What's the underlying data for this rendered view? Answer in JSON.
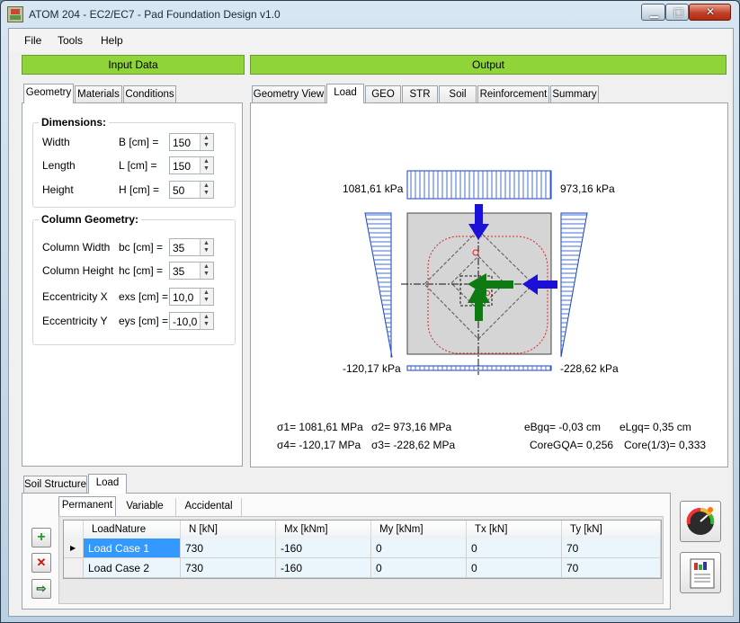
{
  "window": {
    "title": "ATOM 204 - EC2/EC7 - Pad Foundation Design v1.0"
  },
  "controls": {
    "min": "▁",
    "max": "□",
    "close": "✕"
  },
  "menu": [
    "File",
    "Tools",
    "Help"
  ],
  "header": {
    "input": "Input Data",
    "output": "Output"
  },
  "input_tabs": [
    "Geometry",
    "Materials",
    "Conditions"
  ],
  "dimensions": {
    "title": "Dimensions:",
    "rows": [
      {
        "label": "Width",
        "symbol": "B [cm] =",
        "value": "150"
      },
      {
        "label": "Length",
        "symbol": "L [cm] =",
        "value": "150"
      },
      {
        "label": "Height",
        "symbol": "H [cm] =",
        "value": "50"
      }
    ]
  },
  "column": {
    "title": "Column Geometry:",
    "rows": [
      {
        "label": "Column Width",
        "symbol": "bc [cm] =",
        "value": "35"
      },
      {
        "label": "Column Height",
        "symbol": "hc [cm] =",
        "value": "35"
      },
      {
        "label": "Eccentricity X",
        "symbol": "exs [cm] =",
        "value": "10,0"
      },
      {
        "label": "Eccentricity Y",
        "symbol": "eys [cm] =",
        "value": "-10,0"
      }
    ]
  },
  "output_tabs": [
    "Geometry View",
    "Load",
    "GEO",
    "STR",
    "Soil",
    "Reinforcement",
    "Summary"
  ],
  "canvas": {
    "pressure_tl": "1081,61 kPa",
    "pressure_tr": "973,16 kPa",
    "pressure_bl": "-120,17 kPa",
    "pressure_br": "-228,62 kPa",
    "s1": "σ1= 1081,61 MPa",
    "s2": "σ2= 973,16 MPa",
    "s4": "σ4= -120,17 MPa",
    "s3": "σ3= -228,62 MPa",
    "ebgq": "eBgq= -0,03 cm",
    "elgq": "eLgq= 0,35 cm",
    "coregqa": "CoreGQA= 0,256",
    "core13": "Core(1/3)= 0,333",
    "colors": {
      "arrow_axial": "#1a10d8",
      "arrow_moment": "#0f7a12",
      "diagram_fill": "#3f6fd6",
      "core_dash": "#e0202a"
    }
  },
  "bottom_tabs": [
    "Soil Structure",
    "Load"
  ],
  "load_tabs": [
    "Permanent",
    "Variable",
    "Accidental"
  ],
  "table": {
    "headers": [
      "LoadNature",
      "N [kN]",
      "Mx [kNm]",
      "My [kNm]",
      "Tx [kN]",
      "Ty [kN]"
    ],
    "rows": [
      [
        "Load Case 1",
        "730",
        "-160",
        "0",
        "0",
        "70"
      ],
      [
        "Load Case 2",
        "730",
        "-160",
        "0",
        "0",
        "70"
      ]
    ]
  },
  "side_buttons": {
    "add": "+",
    "delete": "✕",
    "export": "⇨"
  }
}
